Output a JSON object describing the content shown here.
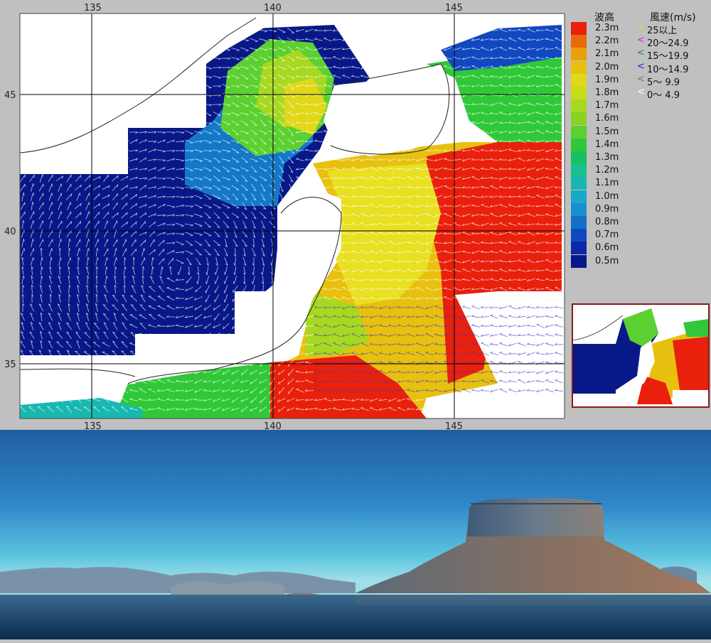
{
  "map": {
    "x_ticks_top": [
      "135",
      "140",
      "145"
    ],
    "x_ticks_bottom": [
      "135",
      "140",
      "145"
    ],
    "y_ticks": [
      "45",
      "40",
      "35"
    ]
  },
  "legend": {
    "wave_title": "波高",
    "wind_title": "風速(m/s)",
    "wave_levels": [
      {
        "label": "2.3m",
        "color": "#e8200c"
      },
      {
        "label": "2.2m",
        "color": "#e8680c"
      },
      {
        "label": "2.1m",
        "color": "#e8a00c"
      },
      {
        "label": "2.0m",
        "color": "#e8c010"
      },
      {
        "label": "1.9m",
        "color": "#e0d818"
      },
      {
        "label": "1.8m",
        "color": "#c8dc18"
      },
      {
        "label": "1.7m",
        "color": "#a8d820"
      },
      {
        "label": "1.6m",
        "color": "#88d420"
      },
      {
        "label": "1.5m",
        "color": "#5cd030"
      },
      {
        "label": "1.4m",
        "color": "#30c838"
      },
      {
        "label": "1.3m",
        "color": "#18c060"
      },
      {
        "label": "1.2m",
        "color": "#18c090"
      },
      {
        "label": "1.1m",
        "color": "#18b8b0"
      },
      {
        "label": "1.0m",
        "color": "#18a8c8"
      },
      {
        "label": "0.9m",
        "color": "#1890d0"
      },
      {
        "label": "0.8m",
        "color": "#1470c8"
      },
      {
        "label": "0.7m",
        "color": "#1048c0"
      },
      {
        "label": "0.6m",
        "color": "#0c28a8"
      },
      {
        "label": "0.5m",
        "color": "#081888"
      }
    ],
    "wind_levels": [
      {
        "label": "25以上",
        "color": "#e8e020"
      },
      {
        "label": "20～24.9",
        "color": "#d020d0"
      },
      {
        "label": "15～19.9",
        "color": "#209020"
      },
      {
        "label": "10～14.9",
        "color": "#2020d0"
      },
      {
        "label": "5～ 9.9",
        "color": "#707070"
      },
      {
        "label": "0～ 4.9",
        "color": "#ffffff"
      }
    ]
  }
}
